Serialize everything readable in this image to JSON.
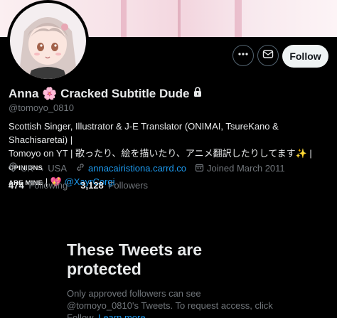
{
  "profile": {
    "name": "Anna 🌸 Cracked Subtitle Dude",
    "handle": "@tomoyo_0810",
    "bio_line1": "Scottish Singer, Illustrator & J-E Translator (ONIMAI, TsureKano & Shachisaretai) |",
    "bio_line2": "Tomoyo on YT | 歌ったり、絵を描いたり、アニメ翻訳したりしてます✨ |",
    "bio_caps1": "OPINIONS",
    "bio_caps2": "ARE MINE",
    "bio_sep": "|",
    "bio_heart": "💖",
    "bio_mention": "@XayrCorgi",
    "location": "UK → USA",
    "website": "annacairistiona.carrd.co",
    "joined": "Joined March 2011",
    "following_count": "474",
    "following_label": "Following",
    "followers_count": "3,128",
    "followers_label": "Followers"
  },
  "actions": {
    "follow_label": "Follow",
    "more_icon": "more-horizontal-icon",
    "message_icon": "envelope-icon"
  },
  "protected": {
    "title": "These Tweets are protected",
    "text": "Only approved followers can see @tomoyo_0810's Tweets. To request access, click Follow.",
    "learn_more": "Learn more"
  },
  "colors": {
    "accent": "#1d9bf0",
    "muted": "#71767b",
    "text": "#e7e9ea",
    "background": "#000000",
    "follow_bg": "#eff3f4"
  }
}
